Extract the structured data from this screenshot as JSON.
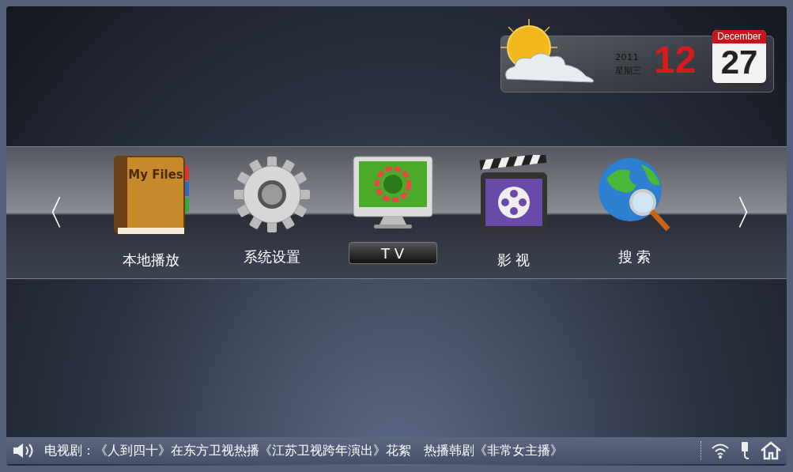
{
  "clock": {
    "year": "2011",
    "weekday": "星期三",
    "hour": "12",
    "month": "December",
    "day": "27"
  },
  "nav": {
    "prev": "〈",
    "next": "〉"
  },
  "menu": [
    {
      "label": "本地播放",
      "kind": "book",
      "icon_text": "My Files",
      "selected": false
    },
    {
      "label": "系统设置",
      "kind": "gear",
      "selected": false
    },
    {
      "label": "T V",
      "kind": "monitor",
      "selected": true
    },
    {
      "label": "影 视",
      "kind": "film",
      "selected": false
    },
    {
      "label": "搜 索",
      "kind": "globe",
      "selected": false
    }
  ],
  "ticker": {
    "text": "电视剧：《人到四十》在东方卫视热播《江苏卫视跨年演出》花絮　热播韩剧《非常女主播》"
  }
}
